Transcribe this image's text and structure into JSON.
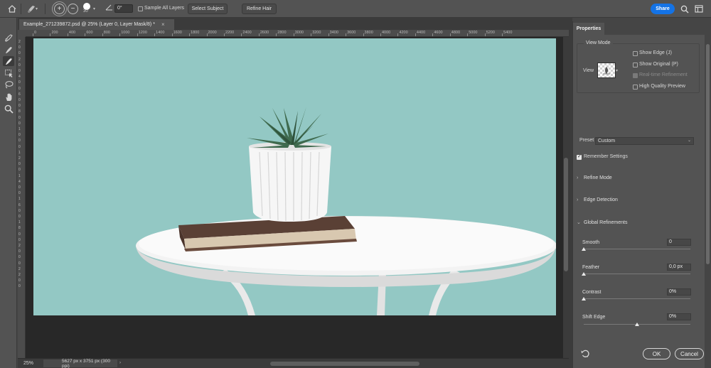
{
  "options_bar": {
    "icons": [
      "home-icon",
      "refine-edge-brush-icon",
      "add-to-selection-icon",
      "subtract-from-selection-icon",
      "brush-preset-icon",
      "angle-icon"
    ],
    "brush_size": "30",
    "angle_value": "0°",
    "sample_all_layers": {
      "label": "Sample All Layers",
      "checked": false
    },
    "select_subject_label": "Select Subject",
    "refine_hair_label": "Refine Hair",
    "share_label": "Share",
    "right_icons": [
      "search-icon",
      "workspace-icon"
    ],
    "share_color": "#1473e6"
  },
  "toolbar": {
    "tools": [
      "quick-selection-tool-icon",
      "refine-edge-brush-tool-icon",
      "brush-tool-icon",
      "object-selection-tool-icon",
      "lasso-tool-icon",
      "hand-tool-icon",
      "zoom-tool-icon"
    ],
    "active_tool": "brush-tool-icon"
  },
  "document": {
    "tab_title": "Example_271239872.psd @ 25% (Layer 0, Layer Mask/8) *",
    "ruler_h": [
      "0",
      "200",
      "400",
      "600",
      "800",
      "1000",
      "1200",
      "1400",
      "1600",
      "1800",
      "2000",
      "2200",
      "2400",
      "2600",
      "2800",
      "3000",
      "3200",
      "3400",
      "3600",
      "3800",
      "4000",
      "4200",
      "4400",
      "4600",
      "4800",
      "5000",
      "5200",
      "5400"
    ],
    "ruler_v": [
      "2",
      "0",
      "0",
      "2",
      "0",
      "0",
      "4",
      "0",
      "0",
      "6",
      "0",
      "0",
      "8",
      "0",
      "0",
      "1",
      "0",
      "0",
      "0",
      "1",
      "2",
      "0",
      "0",
      "1",
      "4",
      "0",
      "0",
      "1",
      "6",
      "0",
      "0",
      "1",
      "8",
      "0",
      "0",
      "2",
      "0",
      "0",
      "0",
      "2",
      "2",
      "0",
      "0"
    ],
    "canvas_bg": "#93c8c4"
  },
  "status": {
    "zoom": "25%",
    "doc_info": "5627 px x 3751 px (300 ppi)"
  },
  "properties": {
    "tab_label": "Properties",
    "view_mode": {
      "legend": "View Mode",
      "view_label": "View",
      "options": [
        {
          "label": "Show Edge (J)",
          "checked": false,
          "enabled": true
        },
        {
          "label": "Show Original (P)",
          "checked": false,
          "enabled": true
        },
        {
          "label": "Real-time Refinement",
          "checked": true,
          "enabled": false
        },
        {
          "label": "High Quality Preview",
          "checked": false,
          "enabled": true
        }
      ]
    },
    "preset_label": "Preset",
    "preset_value": "Custom",
    "remember_settings": {
      "label": "Remember Settings",
      "checked": true
    },
    "sections": [
      {
        "label": "Refine Mode",
        "expanded": false
      },
      {
        "label": "Edge Detection",
        "expanded": false
      },
      {
        "label": "Global Refinements",
        "expanded": true
      }
    ],
    "sliders": [
      {
        "label": "Smooth",
        "value": "0",
        "fraction": 0.0
      },
      {
        "label": "Feather",
        "value": "0,0 px",
        "fraction": 0.0
      },
      {
        "label": "Contrast",
        "value": "0%",
        "fraction": 0.0
      },
      {
        "label": "Shift Edge",
        "value": "0%",
        "fraction": 0.5
      }
    ],
    "ok_label": "OK",
    "cancel_label": "Cancel"
  }
}
